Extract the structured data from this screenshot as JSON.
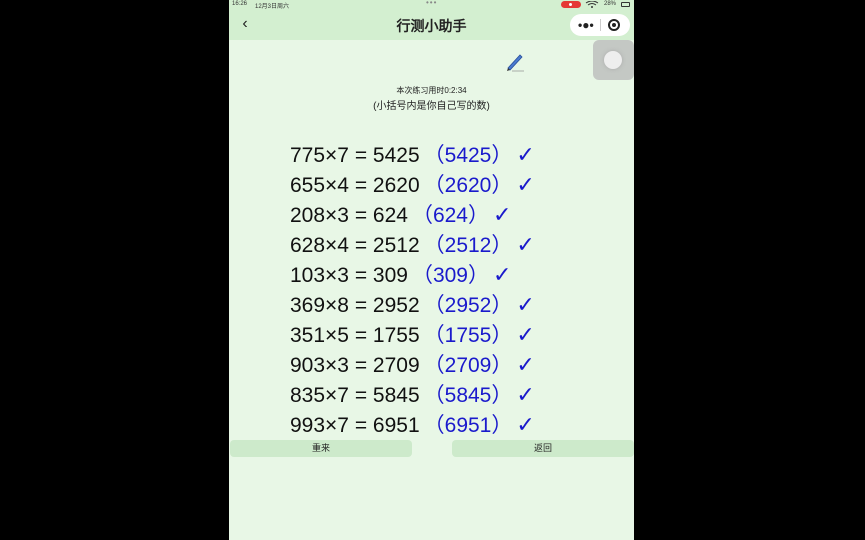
{
  "status": {
    "time": "16:26",
    "date": "12月3日周六",
    "battery": "28%"
  },
  "nav": {
    "back": "‹",
    "title": "行测小助手",
    "more": "•●•"
  },
  "practice": {
    "timer": "本次练习用时0:2:34",
    "hint": "(小括号内是你自己写的数)"
  },
  "results": [
    {
      "eq": "775×7 = 5425",
      "ans": "（5425）",
      "mark": "✓"
    },
    {
      "eq": "655×4 = 2620",
      "ans": "（2620）",
      "mark": "✓"
    },
    {
      "eq": "208×3 = 624",
      "ans": "（624）",
      "mark": "✓"
    },
    {
      "eq": "628×4 = 2512",
      "ans": "（2512）",
      "mark": "✓"
    },
    {
      "eq": "103×3 = 309",
      "ans": "（309）",
      "mark": "✓"
    },
    {
      "eq": "369×8 = 2952",
      "ans": "（2952）",
      "mark": "✓"
    },
    {
      "eq": "351×5 = 1755",
      "ans": "（1755）",
      "mark": "✓"
    },
    {
      "eq": "903×3 = 2709",
      "ans": "（2709）",
      "mark": "✓"
    },
    {
      "eq": "835×7 = 5845",
      "ans": "（5845）",
      "mark": "✓"
    },
    {
      "eq": "993×7 = 6951",
      "ans": "（6951）",
      "mark": "✓"
    }
  ],
  "buttons": {
    "redo": "重来",
    "back": "返回"
  },
  "colors": {
    "background": "#e8f7e6",
    "navbar": "#d3efd0",
    "button": "#cdeacb",
    "answer": "#1a1acc",
    "black_frame": "#000000"
  }
}
